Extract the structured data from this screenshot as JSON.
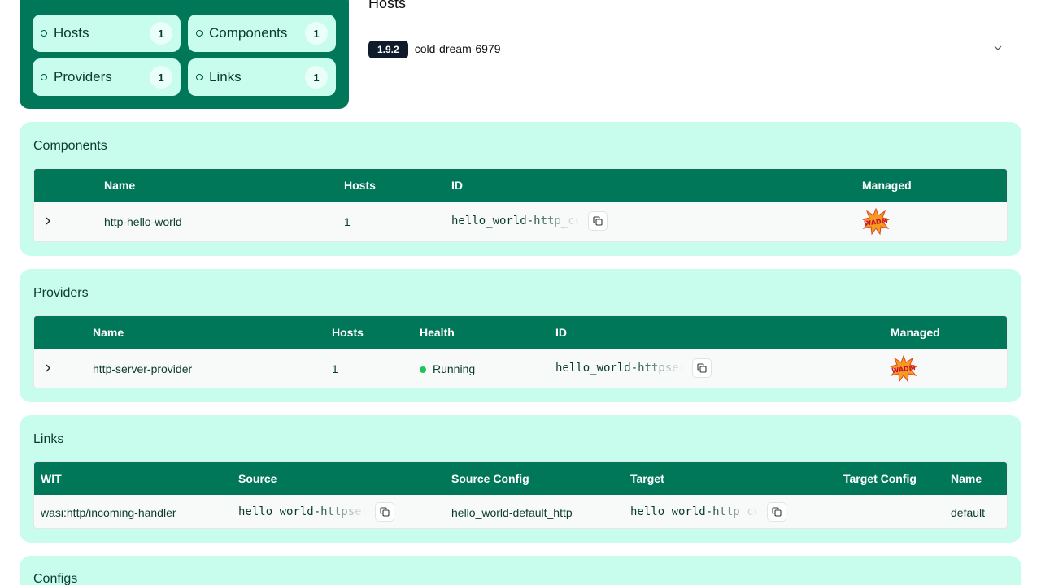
{
  "summary": {
    "stats": [
      {
        "label": "Hosts",
        "count": "1"
      },
      {
        "label": "Components",
        "count": "1"
      },
      {
        "label": "Providers",
        "count": "1"
      },
      {
        "label": "Links",
        "count": "1"
      }
    ]
  },
  "hosts": {
    "title": "Hosts",
    "items": [
      {
        "version": "1.9.2",
        "name": "cold-dream-6979"
      }
    ]
  },
  "components": {
    "title": "Components",
    "headers": {
      "name": "Name",
      "hosts": "Hosts",
      "id": "ID",
      "managed": "Managed"
    },
    "rows": [
      {
        "name": "http-hello-world",
        "hosts": "1",
        "id": "hello_world-http_component",
        "managed_icon": "wadm-badge-icon"
      }
    ]
  },
  "providers": {
    "title": "Providers",
    "headers": {
      "name": "Name",
      "hosts": "Hosts",
      "health": "Health",
      "id": "ID",
      "managed": "Managed"
    },
    "rows": [
      {
        "name": "http-server-provider",
        "hosts": "1",
        "health": "Running",
        "id": "hello_world-httpserver",
        "managed_icon": "wadm-badge-icon"
      }
    ]
  },
  "links": {
    "title": "Links",
    "headers": {
      "wit": "WIT",
      "source": "Source",
      "source_config": "Source Config",
      "target": "Target",
      "target_config": "Target Config",
      "name": "Name"
    },
    "rows": [
      {
        "wit": "wasi:http/incoming-handler",
        "source": "hello_world-httpserver",
        "source_config": "hello_world-default_http",
        "target": "hello_world-http_component",
        "target_config": "",
        "name": "default"
      }
    ]
  },
  "configs": {
    "title": "Configs"
  },
  "colors": {
    "brand": "#01775a",
    "panel": "#c8fdee",
    "running": "#1cc45a"
  }
}
